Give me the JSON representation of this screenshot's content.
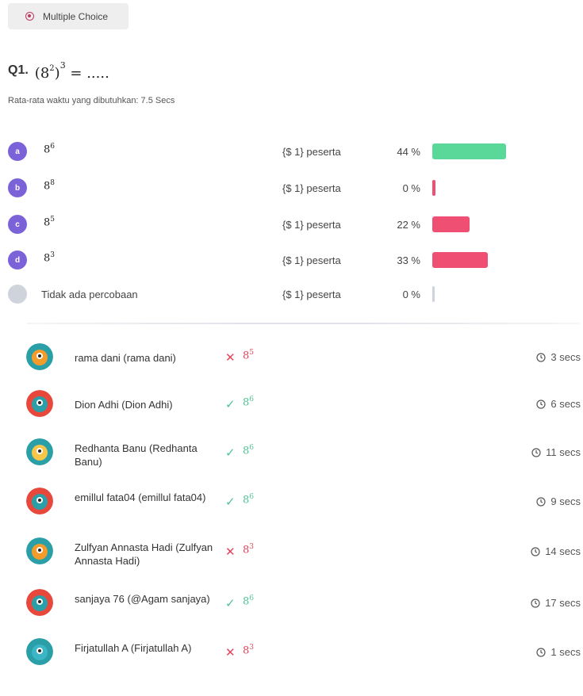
{
  "question_type": "Multiple Choice",
  "question": {
    "number": "Q1.",
    "base": "8",
    "inner_exp": "2",
    "outer_exp": "3",
    "tail": " = ....."
  },
  "avg_time": "Rata-rata waktu yang dibutuhkan: 7.5 Secs",
  "options": [
    {
      "letter": "a",
      "base": "8",
      "exp": "6",
      "participants": "{$ 1} peserta",
      "percent_label": "44 %",
      "percent": 44,
      "color": "#5ad899"
    },
    {
      "letter": "b",
      "base": "8",
      "exp": "8",
      "participants": "{$ 1} peserta",
      "percent_label": "0 %",
      "percent": 0,
      "color": "#ef4f72"
    },
    {
      "letter": "c",
      "base": "8",
      "exp": "5",
      "participants": "{$ 1} peserta",
      "percent_label": "22 %",
      "percent": 22,
      "color": "#ef4f72"
    },
    {
      "letter": "d",
      "base": "8",
      "exp": "3",
      "participants": "{$ 1} peserta",
      "percent_label": "33 %",
      "percent": 33,
      "color": "#ef4f72"
    }
  ],
  "no_attempt": {
    "label": "Tidak ada percobaan",
    "participants": "{$ 1} peserta",
    "percent_label": "0 %",
    "percent": 0,
    "color": "#cfd4dc"
  },
  "responses": [
    {
      "name": "rama dani (rama dani)",
      "correct": false,
      "base": "8",
      "exp": "5",
      "time": "3 secs",
      "avatar": "orange-monster"
    },
    {
      "name": "Dion Adhi (Dion Adhi)",
      "correct": true,
      "base": "8",
      "exp": "6",
      "time": "6 secs",
      "avatar": "red-monster"
    },
    {
      "name": "Redhanta Banu (Redhanta Banu)",
      "correct": true,
      "base": "8",
      "exp": "6",
      "time": "11 secs",
      "avatar": "yellow-monster"
    },
    {
      "name": "emillul fata04 (emillul fata04)",
      "correct": true,
      "base": "8",
      "exp": "6",
      "time": "9 secs",
      "avatar": "red-monster"
    },
    {
      "name": "Zulfyan Annasta Hadi (Zulfyan Annasta Hadi)",
      "correct": false,
      "base": "8",
      "exp": "3",
      "time": "14 secs",
      "avatar": "orange-monster"
    },
    {
      "name": "sanjaya 76 (@Agam sanjaya)",
      "correct": true,
      "base": "8",
      "exp": "6",
      "time": "17 secs",
      "avatar": "red-monster"
    },
    {
      "name": "Firjatullah A (Firjatullah A)",
      "correct": false,
      "base": "8",
      "exp": "3",
      "time": "1 secs",
      "avatar": "teal-monster"
    }
  ],
  "marks": {
    "wrong": "✕",
    "right": "✓"
  }
}
